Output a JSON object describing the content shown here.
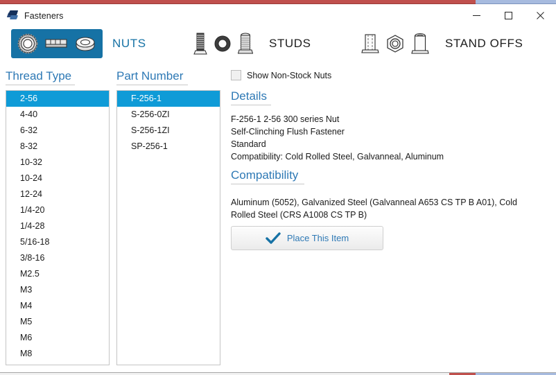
{
  "window": {
    "title": "Fasteners",
    "icon": "fastener-app-icon",
    "controls": {
      "minimize": "minimize-icon",
      "maximize": "maximize-icon",
      "close": "close-icon"
    }
  },
  "accents": {
    "blue": "#2e79b5",
    "selection": "#0f9bd7",
    "tab_selected_bg": "#1672a5",
    "strip_red": "#c0504d",
    "strip_blue": "#a7bbdf"
  },
  "tabs": [
    {
      "id": "nuts",
      "label": "NUTS",
      "selected": true,
      "icons": [
        "round-nut-icon",
        "hex-barrel-nut-icon",
        "flush-washer-nut-icon"
      ]
    },
    {
      "id": "studs",
      "label": "STUDS",
      "selected": false,
      "icons": [
        "threaded-stud-icon",
        "ring-stud-icon",
        "flanged-stud-icon"
      ]
    },
    {
      "id": "standoffs",
      "label": "STAND OFFS",
      "selected": false,
      "icons": [
        "square-standoff-icon",
        "hex-standoff-icon",
        "round-standoff-icon"
      ]
    }
  ],
  "thread_type": {
    "header": "Thread Type",
    "selected": "2-56",
    "items": [
      "2-56",
      "4-40",
      "6-32",
      "8-32",
      "10-32",
      "10-24",
      "12-24",
      "1/4-20",
      "1/4-28",
      "5/16-18",
      "3/8-16",
      "M2.5",
      "M3",
      "M4",
      "M5",
      "M6",
      "M8"
    ]
  },
  "part_number": {
    "header": "Part Number",
    "selected": "F-256-1",
    "items": [
      "F-256-1",
      "S-256-0ZI",
      "S-256-1ZI",
      "SP-256-1"
    ]
  },
  "options": {
    "show_non_stock": {
      "label": "Show Non-Stock Nuts",
      "checked": false
    }
  },
  "details": {
    "header": "Details",
    "lines": [
      "F-256-1 2-56 300 series Nut",
      "Self-Clinching Flush Fastener",
      "Standard",
      "Compatibility: Cold Rolled Steel, Galvanneal, Aluminum"
    ]
  },
  "compatibility": {
    "header": "Compatibility",
    "text": "Aluminum (5052), Galvanized Steel (Galvanneal A653 CS TP B A01), Cold Rolled Steel (CRS A1008 CS TP B)"
  },
  "place_button": {
    "label": "Place This Item",
    "icon": "checkmark-icon"
  }
}
